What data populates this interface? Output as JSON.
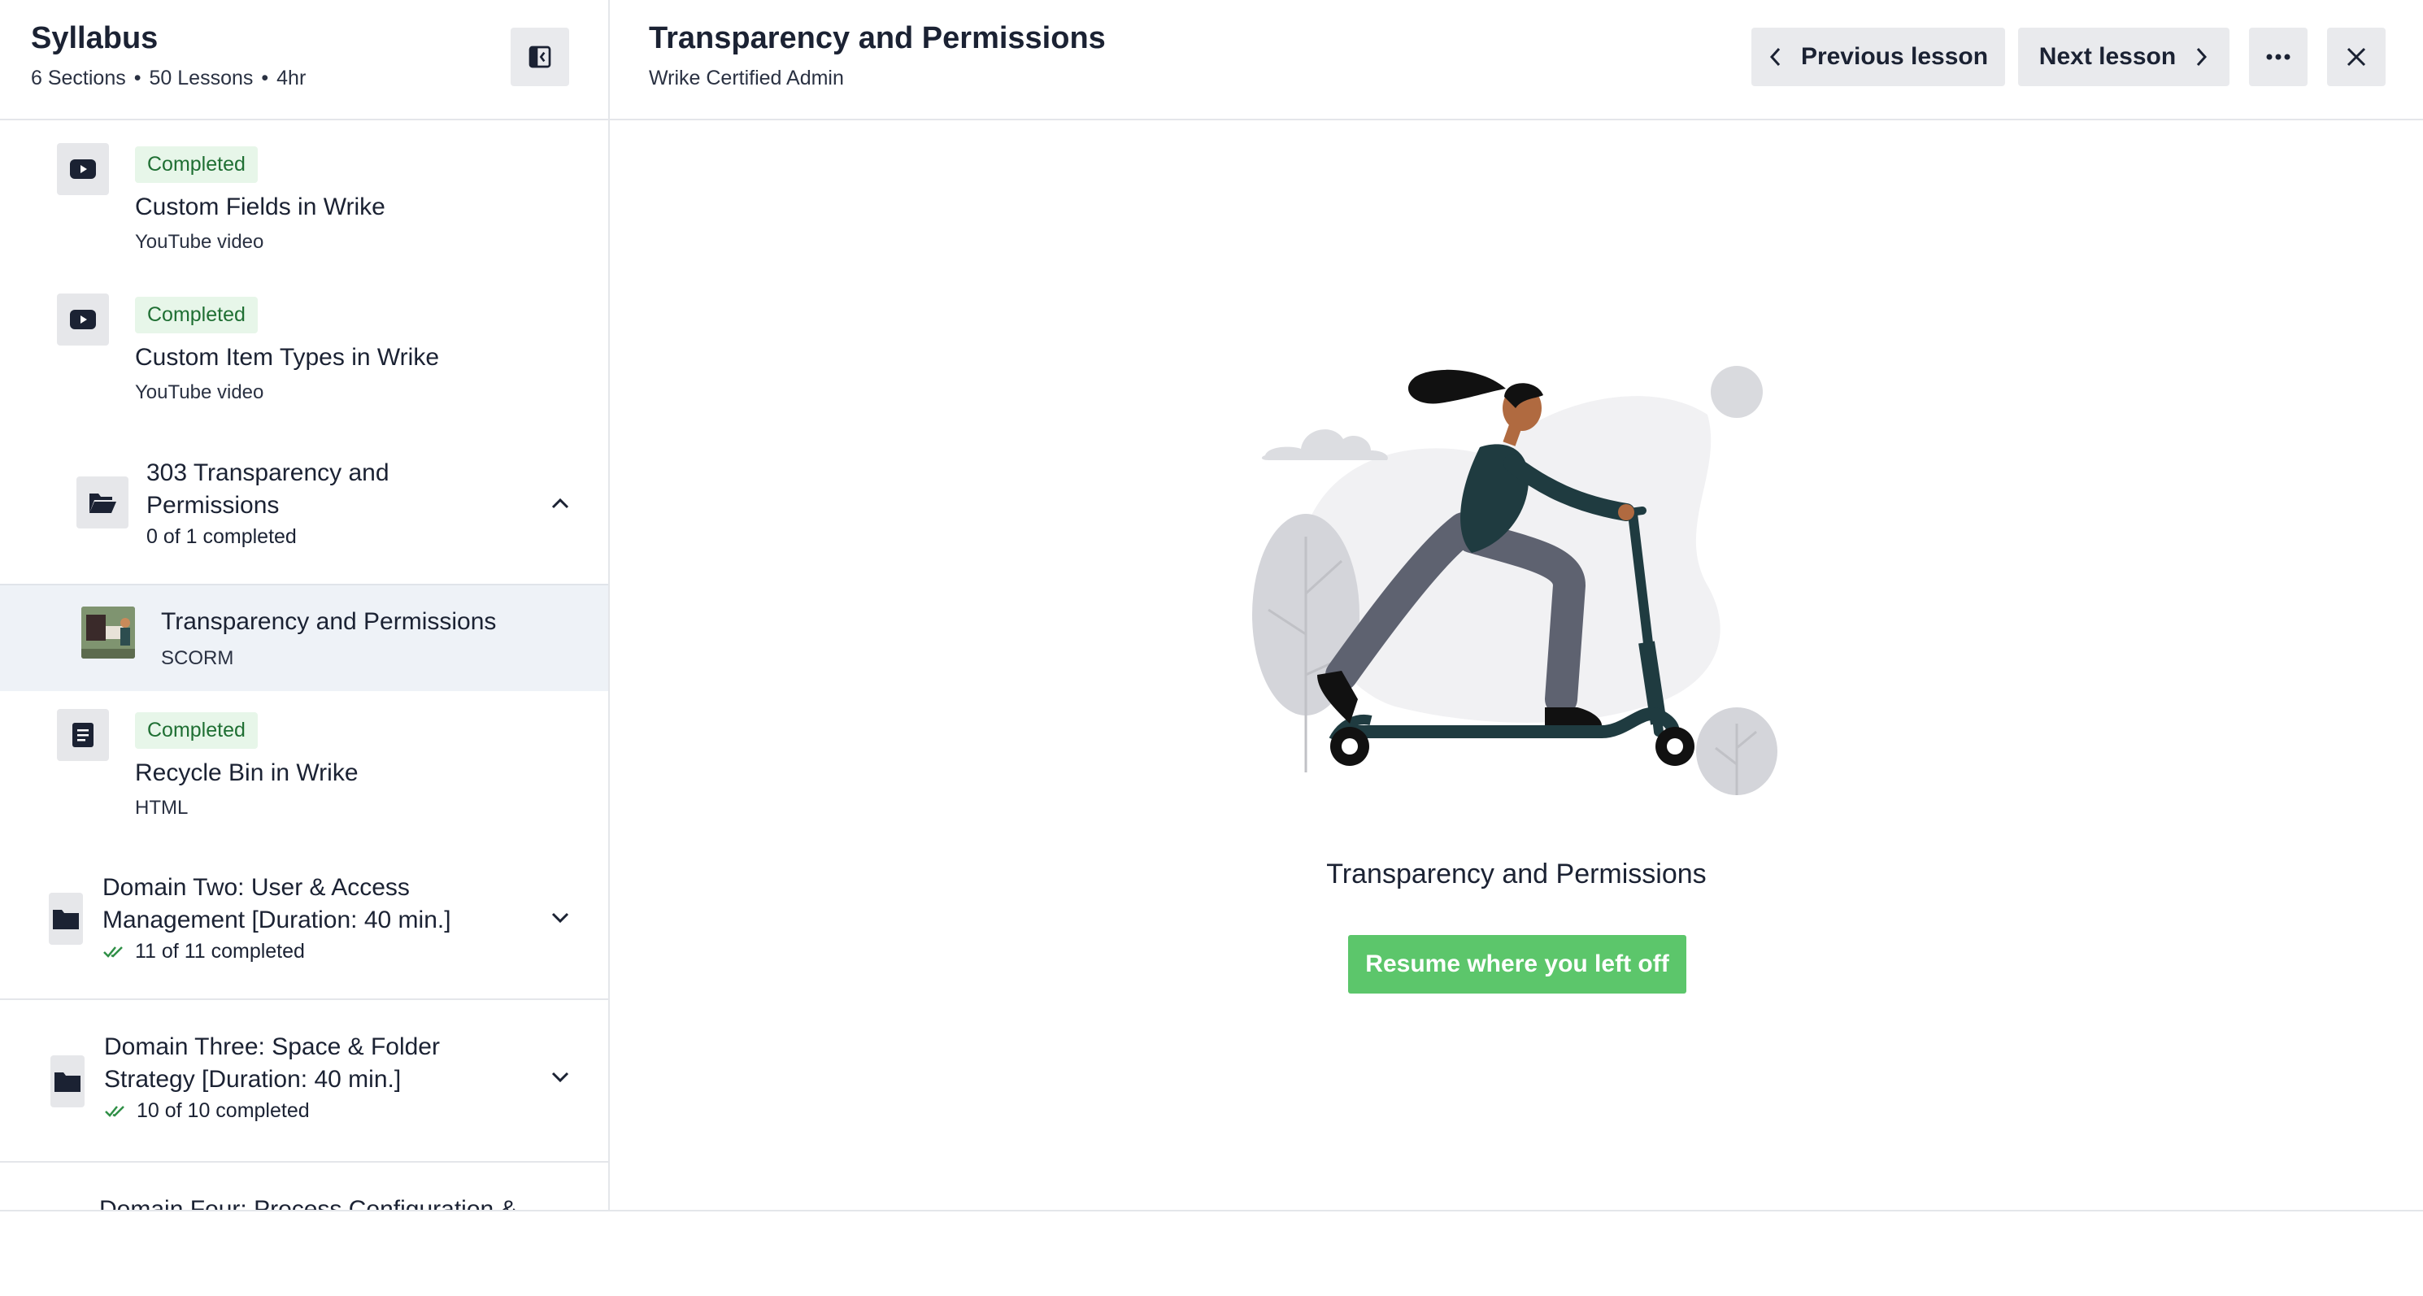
{
  "sidebar": {
    "title": "Syllabus",
    "meta": {
      "sections": "6 Sections",
      "lessons": "50 Lessons",
      "duration": "4hr"
    },
    "lessons": [
      {
        "status": "Completed",
        "title": "Custom Fields in Wrike",
        "type": "YouTube video",
        "icon": "youtube-icon"
      },
      {
        "status": "Completed",
        "title": "Custom Item Types in Wrike",
        "type": "YouTube video",
        "icon": "youtube-icon"
      }
    ],
    "open_section": {
      "title_line1": "303 Transparency and",
      "title_line2": "Permissions",
      "progress": "0 of 1 completed"
    },
    "active_lesson": {
      "title": "Transparency and Permissions",
      "type": "SCORM"
    },
    "lesson_after": {
      "status": "Completed",
      "title": "Recycle Bin in Wrike",
      "type": "HTML",
      "icon": "document-icon"
    },
    "sections": [
      {
        "title_line1": "Domain Two: User & Access",
        "title_line2": "Management [Duration: 40 min.]",
        "progress": "11 of 11 completed"
      },
      {
        "title_line1": "Domain Three: Space & Folder",
        "title_line2": "Strategy [Duration: 40 min.]",
        "progress": "10 of 10 completed"
      }
    ],
    "cut_off_section": "Domain Four: Process Configuration &"
  },
  "main": {
    "title": "Transparency and Permissions",
    "subtitle": "Wrike Certified Admin",
    "prev_label": "Previous lesson",
    "next_label": "Next lesson",
    "content_title": "Transparency and Permissions",
    "resume_label": "Resume where you left off"
  },
  "colors": {
    "accent_green": "#5cc66b",
    "badge_bg": "#e7f6e9",
    "badge_text": "#1f6f33",
    "active_row": "#eef2f7"
  }
}
